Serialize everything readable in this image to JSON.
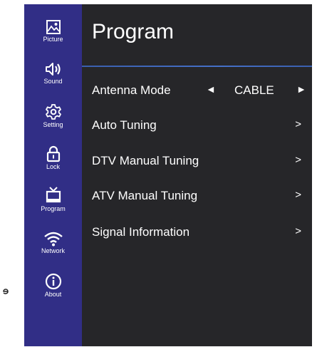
{
  "sidebar": {
    "items": [
      {
        "label": "Picture",
        "icon": "picture-icon"
      },
      {
        "label": "Sound",
        "icon": "speaker-icon"
      },
      {
        "label": "Setting",
        "icon": "gear-icon"
      },
      {
        "label": "Lock",
        "icon": "lock-icon"
      },
      {
        "label": "Program",
        "icon": "tv-icon"
      },
      {
        "label": "Network",
        "icon": "wifi-icon"
      },
      {
        "label": "About",
        "icon": "info-icon"
      }
    ]
  },
  "main": {
    "title": "Program",
    "rows": [
      {
        "label": "Antenna Mode",
        "value": "CABLE",
        "left_arrow": "◄",
        "right_arrow": "►"
      },
      {
        "label": "Auto Tuning",
        "chevron": ">"
      },
      {
        "label": "DTV Manual Tuning",
        "chevron": ">"
      },
      {
        "label": "ATV Manual Tuning",
        "chevron": ">"
      },
      {
        "label": "Signal Information",
        "chevron": ">"
      }
    ]
  },
  "colors": {
    "sidebar_bg": "#312e86",
    "content_bg": "#262629",
    "accent_rule": "#4570c8",
    "text": "#ffffff"
  }
}
